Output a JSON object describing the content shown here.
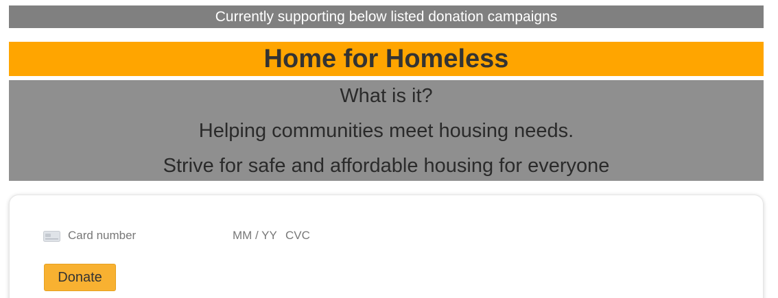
{
  "banner": {
    "text": "Currently supporting below listed donation campaigns"
  },
  "campaign": {
    "title": "Home for Homeless",
    "question": "What is it?",
    "description_lines": [
      "Helping communities meet housing needs.",
      "Strive for safe and affordable housing for everyone"
    ]
  },
  "payment": {
    "card_icon": "credit-card-icon",
    "card_number_placeholder": "Card number",
    "expiry_placeholder": "MM / YY",
    "cvc_placeholder": "CVC",
    "donate_label": "Donate"
  },
  "colors": {
    "banner_bg": "#808080",
    "title_bg": "#ffa500",
    "desc_bg": "#8f8f8f",
    "donate_bg": "#f8b131"
  }
}
